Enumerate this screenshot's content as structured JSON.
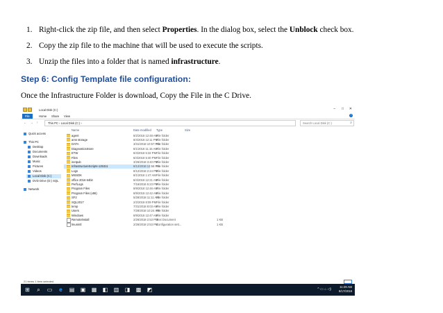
{
  "document": {
    "steps": [
      {
        "num": "1.",
        "before": "Right-click the zip file, and then select ",
        "bold1": "Properties",
        "middle": ". In the dialog box, select the ",
        "bold2": "Unblock",
        "after": " check box."
      },
      {
        "num": "2.",
        "text": "Copy the zip file to the machine that will be used to execute the scripts."
      },
      {
        "num": "3.",
        "before": "Unzip the files into a folder that is named ",
        "bold": "infrastructure",
        "after": "."
      }
    ],
    "heading": "Step 6: Config Template file configuration:",
    "paragraph": "Once the Infrastructure Folder is download, Copy the File in the C Drive."
  },
  "explorer": {
    "window_title": "Local Disk (C:)",
    "window_controls": {
      "minimize": "–",
      "maximize": "□",
      "close": "✕"
    },
    "ribbon_tabs": [
      "File",
      "Home",
      "Share",
      "View"
    ],
    "help": "?",
    "nav_glyphs": "← → ↑",
    "breadcrumb": "This PC  ›  Local Disk (C:)  ›",
    "search_placeholder": "Search Local Disk (C:)",
    "search_icon": "⌕",
    "nav_pane": [
      {
        "label": "Quick access",
        "icon": "star-icon"
      },
      {
        "label": "This PC",
        "icon": "computer-icon"
      },
      {
        "label": "Desktop",
        "icon": "desktop-icon"
      },
      {
        "label": "Documents",
        "icon": "documents-icon"
      },
      {
        "label": "Downloads",
        "icon": "downloads-icon"
      },
      {
        "label": "Music",
        "icon": "music-icon"
      },
      {
        "label": "Pictures",
        "icon": "pictures-icon"
      },
      {
        "label": "Videos",
        "icon": "videos-icon"
      },
      {
        "label": "Local Disk (C:)",
        "icon": "drive-icon",
        "selected": true
      },
      {
        "label": "DVD Drive (D:) SQL",
        "icon": "dvd-icon"
      },
      {
        "label": "Network",
        "icon": "network-icon"
      }
    ],
    "columns": [
      "Name",
      "Date modified",
      "Type",
      "Size"
    ],
    "files": [
      {
        "name": "agent",
        "date": "8/2/2018 12:48 AM",
        "type": "File folder",
        "size": ""
      },
      {
        "name": "ams storage",
        "date": "8/4/2018 12:11 PM",
        "type": "File folder",
        "size": ""
      },
      {
        "name": "DATA",
        "date": "3/31/2018 10:57 PM",
        "type": "File folder",
        "size": ""
      },
      {
        "name": "DiagnosticsStore",
        "date": "8/1/2018 11:15 AM",
        "type": "File folder",
        "size": ""
      },
      {
        "name": "ETW",
        "date": "8/4/2018 5:32 PM",
        "type": "File folder",
        "size": ""
      },
      {
        "name": "Files",
        "date": "8/4/2018 5:40 PM",
        "type": "File folder",
        "size": ""
      },
      {
        "name": "inetpub",
        "date": "3/26/2018 3:40 PM",
        "type": "File folder",
        "size": ""
      },
      {
        "name": "InfrastructureScripts-125311",
        "date": "8/12/2018 12:56 PM",
        "type": "File folder",
        "size": "",
        "selected": true
      },
      {
        "name": "Logs",
        "date": "8/12/2018 2:24 PM",
        "type": "File folder",
        "size": ""
      },
      {
        "name": "MSSDK",
        "date": "8/1/2018 1:47 AM",
        "type": "File folder",
        "size": ""
      },
      {
        "name": "office 2016 64bit",
        "date": "8/4/2018 12:21 AM",
        "type": "File folder",
        "size": ""
      },
      {
        "name": "PerfLogs",
        "date": "7/16/2016 5:23 PM",
        "type": "File folder",
        "size": ""
      },
      {
        "name": "Program Files",
        "date": "8/9/2018 12:46 AM",
        "type": "File folder",
        "size": ""
      },
      {
        "name": "Program Files (x86)",
        "date": "8/9/2018 12:42 AM",
        "type": "File folder",
        "size": ""
      },
      {
        "name": "SF2",
        "date": "5/28/2018 11:11 AM",
        "type": "File folder",
        "size": ""
      },
      {
        "name": "SQL2017",
        "date": "2/2/2018 8:09 PM",
        "type": "File folder",
        "size": ""
      },
      {
        "name": "temp",
        "date": "7/31/2018 8:03 AM",
        "type": "File folder",
        "size": ""
      },
      {
        "name": "Users",
        "date": "7/28/2018 10:24 AM",
        "type": "File folder",
        "size": ""
      },
      {
        "name": "Windows",
        "date": "8/9/2018 12:47 AM",
        "type": "File folder",
        "size": ""
      },
      {
        "name": "Remotelnstall",
        "date": "2/26/2018 2:53 PM",
        "type": "Text Document",
        "size": "1 KB",
        "doc": true
      },
      {
        "name": "lmunintl",
        "date": "2/26/2018 2:53 PM",
        "type": "Configuration sett...",
        "size": "1 KB",
        "doc": true
      }
    ],
    "status": "21 items    1 item selected",
    "taskbar_icons": [
      {
        "name": "start-icon",
        "glyph": "⊞"
      },
      {
        "name": "search-icon",
        "glyph": "⌕"
      },
      {
        "name": "task-view-icon",
        "glyph": "▭"
      },
      {
        "name": "edge-icon",
        "glyph": "e"
      },
      {
        "name": "file-explorer-icon",
        "glyph": "▤"
      },
      {
        "name": "app-icon-1",
        "glyph": "▣"
      },
      {
        "name": "app-icon-2",
        "glyph": "▦"
      },
      {
        "name": "app-icon-3",
        "glyph": "◧"
      },
      {
        "name": "app-icon-4",
        "glyph": "▥"
      },
      {
        "name": "app-icon-5",
        "glyph": "◨"
      },
      {
        "name": "app-icon-6",
        "glyph": "▩"
      },
      {
        "name": "app-icon-7",
        "glyph": "◩"
      }
    ],
    "tray": "^ ▭ ⌂ ◁)",
    "clock_time": "11:28 AM",
    "clock_date": "8/17/2018",
    "colors": {
      "accent": "#1a6fc4",
      "selection": "#cce8ff",
      "heading": "#1f4e99",
      "taskbar": "#0c1a2b",
      "folder": "#f2c94c"
    }
  }
}
